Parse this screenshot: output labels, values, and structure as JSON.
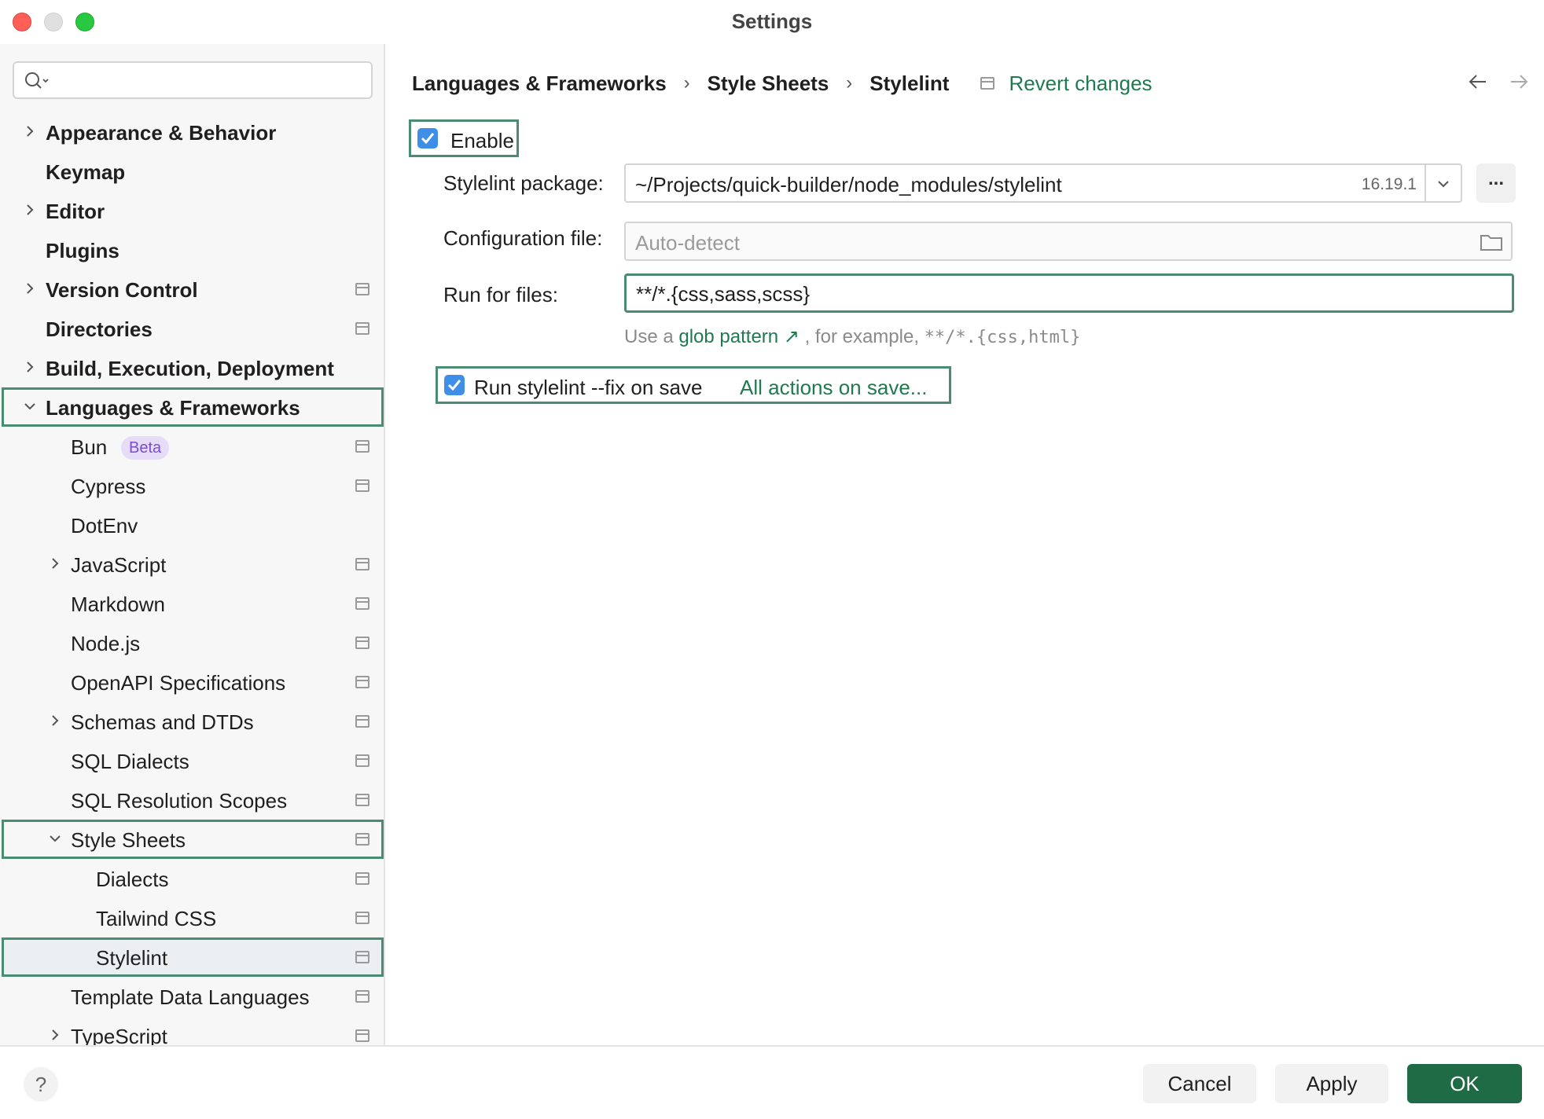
{
  "window": {
    "title": "Settings"
  },
  "search": {
    "placeholder": ""
  },
  "sidebar": {
    "items": [
      {
        "label": "Appearance & Behavior",
        "bold": true,
        "level": 0,
        "chevron": "right",
        "project": false
      },
      {
        "label": "Keymap",
        "bold": true,
        "level": 0,
        "chevron": "",
        "project": false
      },
      {
        "label": "Editor",
        "bold": true,
        "level": 0,
        "chevron": "right",
        "project": false
      },
      {
        "label": "Plugins",
        "bold": true,
        "level": 0,
        "chevron": "",
        "project": false
      },
      {
        "label": "Version Control",
        "bold": true,
        "level": 0,
        "chevron": "right",
        "project": true
      },
      {
        "label": "Directories",
        "bold": true,
        "level": 0,
        "chevron": "",
        "project": true
      },
      {
        "label": "Build, Execution, Deployment",
        "bold": true,
        "level": 0,
        "chevron": "right",
        "project": false
      },
      {
        "label": "Languages & Frameworks",
        "bold": true,
        "level": 0,
        "chevron": "down",
        "project": false
      },
      {
        "label": "Bun",
        "bold": false,
        "level": 1,
        "chevron": "",
        "project": true,
        "badge": "Beta"
      },
      {
        "label": "Cypress",
        "bold": false,
        "level": 1,
        "chevron": "",
        "project": true
      },
      {
        "label": "DotEnv",
        "bold": false,
        "level": 1,
        "chevron": "",
        "project": false
      },
      {
        "label": "JavaScript",
        "bold": false,
        "level": 1,
        "chevron": "right",
        "project": true
      },
      {
        "label": "Markdown",
        "bold": false,
        "level": 1,
        "chevron": "",
        "project": true
      },
      {
        "label": "Node.js",
        "bold": false,
        "level": 1,
        "chevron": "",
        "project": true
      },
      {
        "label": "OpenAPI Specifications",
        "bold": false,
        "level": 1,
        "chevron": "",
        "project": true
      },
      {
        "label": "Schemas and DTDs",
        "bold": false,
        "level": 1,
        "chevron": "right",
        "project": true
      },
      {
        "label": "SQL Dialects",
        "bold": false,
        "level": 1,
        "chevron": "",
        "project": true
      },
      {
        "label": "SQL Resolution Scopes",
        "bold": false,
        "level": 1,
        "chevron": "",
        "project": true
      },
      {
        "label": "Style Sheets",
        "bold": false,
        "level": 1,
        "chevron": "down",
        "project": true
      },
      {
        "label": "Dialects",
        "bold": false,
        "level": 2,
        "chevron": "",
        "project": true
      },
      {
        "label": "Tailwind CSS",
        "bold": false,
        "level": 2,
        "chevron": "",
        "project": true
      },
      {
        "label": "Stylelint",
        "bold": false,
        "level": 2,
        "chevron": "",
        "project": true
      },
      {
        "label": "Template Data Languages",
        "bold": false,
        "level": 1,
        "chevron": "",
        "project": true
      },
      {
        "label": "TypeScript",
        "bold": false,
        "level": 1,
        "chevron": "right",
        "project": true
      }
    ]
  },
  "breadcrumb": {
    "items": [
      "Languages & Frameworks",
      "Style Sheets",
      "Stylelint"
    ],
    "separator": "›",
    "revert_label": "Revert changes"
  },
  "form": {
    "enable_label": "Enable",
    "enable_checked": true,
    "package_label": "Stylelint package:",
    "package_value": "~/Projects/quick-builder/node_modules/stylelint",
    "package_version": "16.19.1",
    "more_label": "...",
    "config_label": "Configuration file:",
    "config_placeholder": "Auto-detect",
    "run_label": "Run for files:",
    "run_value": "**/*.{css,sass,scss}",
    "hint_prefix": "Use a",
    "hint_link": "glob pattern ↗",
    "hint_mid": ", for example,",
    "hint_example": "**/*.{css,html}",
    "fix_label": "Run stylelint --fix on save",
    "fix_checked": true,
    "fix_link": "All actions on save..."
  },
  "footer": {
    "help_label": "?",
    "cancel_label": "Cancel",
    "apply_label": "Apply",
    "ok_label": "OK"
  },
  "colors": {
    "accent_green": "#1e6b45",
    "link_green": "#1f7a4f",
    "checkbox_blue": "#3f8fe8",
    "highlight_border": "#4a8c72",
    "beta_bg": "#e6dcf7",
    "beta_text": "#7a4fc9"
  }
}
